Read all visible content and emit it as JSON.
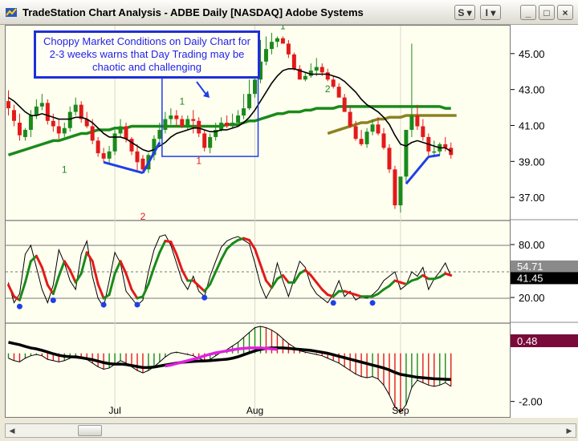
{
  "window": {
    "title": "TradeStation Chart Analysis - ADBE Daily [NASDAQ] Adobe Systems",
    "buttons": {
      "s_label": "S",
      "i_label": "I",
      "min_label": "_",
      "max_label": "□",
      "close_label": "×"
    }
  },
  "annotation": {
    "callout_text": "Choppy Market Conditions on Daily Chart for 2-3 weeks warns that Day Trading may be chaotic and challenging"
  },
  "chart_data": [
    {
      "type": "candlestick",
      "panel": "price",
      "symbol": "ADBE Daily [NASDAQ]",
      "ylim": [
        35.8,
        46.6
      ],
      "y_ticks": [
        "45.00",
        "43.00",
        "41.00",
        "39.00",
        "37.00"
      ],
      "annotations": [
        "1",
        "2",
        "1",
        "1",
        "2",
        "1"
      ],
      "colors": {
        "up": "#1a8a1a",
        "down": "#e21a1a",
        "fast_ma": "#000000",
        "mid_ma": "#1a8a1a",
        "slow_ma": "#8c8220",
        "divergence": "#1f3fe6"
      },
      "x": [
        1,
        2,
        3,
        4,
        5,
        6,
        7,
        8,
        9,
        10,
        11,
        12,
        13,
        14,
        15,
        16,
        17,
        18,
        19,
        20,
        21,
        22,
        23,
        24,
        25,
        26,
        27,
        28,
        29,
        30,
        31,
        32,
        33,
        34,
        35,
        36,
        37,
        38,
        39,
        40,
        41,
        42,
        43,
        44,
        45,
        46,
        47,
        48,
        49,
        50,
        51,
        52,
        53,
        54,
        55,
        56,
        57,
        58,
        59,
        60,
        61,
        62,
        63,
        64,
        65,
        66,
        67,
        68,
        69,
        70,
        71,
        72,
        73,
        74,
        75,
        76,
        77,
        78,
        79,
        80,
        81,
        82,
        83,
        84,
        85,
        86,
        87,
        88,
        89,
        90
      ],
      "open": [
        42.4,
        41.9,
        41.2,
        40.4,
        40.8,
        41.6,
        42.1,
        42.3,
        41.3,
        41.0,
        40.6,
        40.9,
        41.8,
        42.2,
        41.4,
        41.0,
        40.2,
        39.5,
        39.2,
        39.6,
        40.6,
        41.0,
        40.3,
        39.6,
        39.2,
        38.6,
        39.4,
        40.3,
        40.8,
        41.4,
        41.6,
        41.4,
        41.0,
        41.4,
        41.3,
        40.6,
        39.8,
        40.4,
        40.8,
        41.2,
        41.0,
        41.2,
        41.6,
        42.0,
        42.8,
        43.6,
        44.6,
        45.3,
        45.7,
        45.9,
        45.6,
        45.0,
        44.2,
        43.6,
        43.8,
        44.1,
        44.3,
        44.0,
        43.6,
        43.2,
        42.6,
        41.8,
        41.0,
        40.3,
        40.0,
        40.7,
        41.1,
        40.6,
        39.8,
        38.6,
        36.6,
        38.2,
        40.8,
        41.6,
        41.0,
        40.4,
        39.6,
        39.6,
        40.0,
        39.8
      ],
      "high": [
        43.0,
        42.2,
        41.7,
        40.9,
        41.9,
        42.5,
        42.8,
        42.5,
        41.7,
        41.4,
        41.2,
        42.1,
        42.6,
        42.4,
        41.8,
        41.4,
        40.4,
        39.8,
        39.9,
        40.8,
        41.4,
        41.2,
        40.4,
        40.0,
        39.4,
        39.5,
        40.5,
        41.2,
        41.8,
        42.0,
        41.9,
        41.6,
        41.6,
        41.9,
        41.5,
        40.8,
        40.6,
        41.2,
        41.5,
        41.6,
        41.7,
        41.9,
        42.8,
        43.6,
        44.6,
        45.8,
        46.0,
        46.2,
        46.0,
        46.0,
        45.8,
        45.1,
        44.4,
        44.0,
        44.5,
        44.8,
        44.5,
        44.2,
        43.8,
        43.4,
        42.8,
        42.1,
        41.3,
        40.8,
        40.9,
        41.4,
        41.5,
        40.9,
        40.0,
        38.8,
        37.8,
        40.6,
        45.6,
        42.2,
        41.4,
        40.6,
        40.2,
        40.1,
        40.4,
        40.1
      ],
      "low": [
        41.6,
        41.0,
        40.2,
        40.2,
        40.4,
        41.4,
        41.9,
        41.1,
        40.7,
        40.3,
        40.4,
        40.7,
        41.6,
        41.2,
        40.9,
        40.0,
        39.3,
        39.0,
        38.9,
        39.4,
        40.4,
        40.1,
        39.4,
        38.5,
        38.4,
        38.4,
        39.1,
        40.1,
        40.6,
        41.1,
        41.0,
        40.9,
        40.8,
        40.6,
        40.4,
        39.6,
        39.5,
        40.2,
        40.7,
        40.9,
        40.9,
        41.2,
        41.4,
        41.9,
        42.6,
        43.4,
        44.4,
        45.0,
        45.4,
        45.6,
        44.8,
        44.1,
        43.6,
        43.5,
        43.7,
        43.8,
        43.8,
        43.5,
        43.1,
        42.6,
        41.8,
        40.9,
        40.2,
        39.9,
        39.8,
        40.5,
        40.5,
        39.7,
        38.4,
        36.4,
        36.2,
        37.8,
        40.4,
        40.8,
        40.2,
        39.3,
        39.4,
        39.4,
        39.6,
        39.2
      ],
      "close": [
        42.0,
        41.3,
        40.5,
        40.8,
        41.6,
        42.1,
        42.3,
        41.3,
        41.0,
        40.6,
        40.9,
        41.8,
        42.2,
        41.4,
        41.0,
        40.2,
        39.5,
        39.2,
        39.6,
        40.6,
        41.0,
        40.3,
        39.6,
        39.0,
        38.6,
        39.4,
        40.3,
        40.8,
        41.4,
        41.6,
        41.4,
        41.0,
        41.4,
        41.3,
        40.6,
        39.8,
        40.4,
        40.8,
        41.2,
        41.0,
        41.2,
        41.6,
        42.0,
        42.8,
        43.6,
        44.6,
        45.3,
        45.7,
        45.9,
        45.6,
        45.0,
        44.2,
        43.6,
        43.8,
        44.1,
        44.3,
        44.0,
        43.6,
        43.2,
        42.6,
        41.8,
        41.0,
        40.3,
        40.0,
        40.7,
        41.1,
        40.6,
        39.8,
        38.6,
        36.6,
        38.2,
        40.8,
        41.6,
        41.0,
        40.4,
        39.6,
        39.6,
        40.0,
        39.8,
        39.4
      ],
      "ma_fast": [
        42.6,
        42.4,
        42.1,
        41.8,
        41.6,
        41.6,
        41.7,
        41.6,
        41.5,
        41.4,
        41.4,
        41.4,
        41.5,
        41.5,
        41.4,
        41.2,
        40.9,
        40.6,
        40.4,
        40.4,
        40.4,
        40.3,
        40.1,
        39.9,
        39.7,
        39.6,
        39.7,
        39.9,
        40.1,
        40.4,
        40.6,
        40.7,
        40.8,
        40.9,
        40.9,
        40.8,
        40.7,
        40.7,
        40.8,
        40.8,
        40.9,
        41.0,
        41.2,
        41.5,
        41.9,
        42.4,
        42.9,
        43.4,
        43.8,
        44.1,
        44.2,
        44.2,
        44.1,
        44.0,
        43.9,
        43.9,
        43.9,
        43.9,
        43.8,
        43.7,
        43.5,
        43.2,
        42.9,
        42.5,
        42.2,
        42.0,
        41.8,
        41.5,
        41.1,
        40.5,
        40.0,
        39.9,
        40.1,
        40.2,
        40.1,
        40.0,
        39.9,
        39.8,
        39.8,
        39.6
      ],
      "ma_mid": [
        39.4,
        39.5,
        39.6,
        39.7,
        39.8,
        39.9,
        40.0,
        40.1,
        40.2,
        40.2,
        40.3,
        40.4,
        40.5,
        40.6,
        40.6,
        40.7,
        40.8,
        40.8,
        40.8,
        40.9,
        40.9,
        40.9,
        41.0,
        41.0,
        41.0,
        41.0,
        41.0,
        41.0,
        41.0,
        41.0,
        41.0,
        41.0,
        41.0,
        41.0,
        41.0,
        41.0,
        41.0,
        41.0,
        41.0,
        41.1,
        41.1,
        41.1,
        41.2,
        41.3,
        41.3,
        41.4,
        41.5,
        41.6,
        41.7,
        41.7,
        41.8,
        41.8,
        41.8,
        41.9,
        41.9,
        42.0,
        42.0,
        42.0,
        42.0,
        42.1,
        42.1,
        42.1,
        42.1,
        42.1,
        42.1,
        42.1,
        42.1,
        42.1,
        42.1,
        42.1,
        42.1,
        42.1,
        42.1,
        42.1,
        42.1,
        42.1,
        42.1,
        42.1,
        42.0,
        42.0
      ],
      "ma_slow_start_index": 57,
      "ma_slow": [
        40.6,
        40.7,
        40.8,
        40.9,
        41.0,
        41.1,
        41.2,
        41.2,
        41.3,
        41.4,
        41.4,
        41.5,
        41.5,
        41.5,
        41.6,
        41.6,
        41.6,
        41.6,
        41.6,
        41.6,
        41.6,
        41.6,
        41.6,
        41.6
      ]
    },
    {
      "type": "line",
      "panel": "stochastic",
      "ylim": [
        0,
        100
      ],
      "y_ticks": [
        "80.00",
        "20.00"
      ],
      "reference_lines": [
        80,
        50,
        20
      ],
      "current_values": [
        "54.71",
        "41.45"
      ],
      "fast_k": [
        38,
        15,
        25,
        70,
        80,
        55,
        30,
        15,
        35,
        75,
        60,
        40,
        30,
        70,
        85,
        45,
        20,
        10,
        40,
        72,
        60,
        28,
        20,
        12,
        18,
        50,
        75,
        90,
        92,
        80,
        60,
        40,
        30,
        45,
        28,
        22,
        45,
        62,
        78,
        85,
        88,
        90,
        86,
        82,
        60,
        35,
        20,
        32,
        60,
        40,
        22,
        42,
        62,
        55,
        35,
        25,
        20,
        15,
        25,
        40,
        22,
        28,
        18,
        22,
        20,
        24,
        30,
        40,
        45,
        50,
        30,
        35,
        50,
        45,
        55,
        30,
        42,
        50,
        60,
        45
      ],
      "slow_d": [
        35,
        22,
        18,
        38,
        62,
        68,
        55,
        35,
        25,
        45,
        62,
        52,
        38,
        48,
        72,
        62,
        36,
        20,
        24,
        48,
        62,
        48,
        30,
        20,
        22,
        36,
        55,
        72,
        85,
        84,
        70,
        52,
        40,
        40,
        34,
        28,
        36,
        50,
        64,
        76,
        82,
        86,
        88,
        86,
        76,
        58,
        40,
        32,
        42,
        46,
        38,
        38,
        48,
        52,
        46,
        38,
        30,
        24,
        22,
        28,
        28,
        26,
        24,
        22,
        22,
        22,
        25,
        30,
        34,
        40,
        38,
        36,
        40,
        42,
        46,
        42,
        42,
        44,
        48,
        46
      ],
      "signal_dots_count": 8
    },
    {
      "type": "histogram",
      "panel": "macd",
      "ylim": [
        -2.6,
        1.2
      ],
      "y_ticks": [
        "-2.00"
      ],
      "current_value": "0.48",
      "histogram": [
        -0.2,
        -0.3,
        -0.35,
        -0.2,
        -0.1,
        -0.05,
        -0.1,
        -0.25,
        -0.3,
        -0.35,
        -0.3,
        -0.2,
        -0.1,
        -0.15,
        -0.25,
        -0.4,
        -0.55,
        -0.65,
        -0.6,
        -0.45,
        -0.3,
        -0.4,
        -0.55,
        -0.7,
        -0.8,
        -0.7,
        -0.55,
        -0.35,
        -0.15,
        0.0,
        0.05,
        0.0,
        -0.05,
        -0.1,
        -0.2,
        -0.3,
        -0.25,
        -0.1,
        0.05,
        0.15,
        0.3,
        0.45,
        0.65,
        0.85,
        1.05,
        1.1,
        1.05,
        0.95,
        0.8,
        0.6,
        0.4,
        0.25,
        0.1,
        0.05,
        0.0,
        -0.05,
        -0.1,
        -0.2,
        -0.3,
        -0.4,
        -0.55,
        -0.7,
        -0.85,
        -0.95,
        -1.0,
        -0.95,
        -1.05,
        -1.3,
        -1.7,
        -2.2,
        -2.4,
        -2.1,
        -1.4,
        -1.1,
        -1.2,
        -1.3,
        -1.35,
        -1.3,
        -1.2,
        -1.35
      ],
      "macd_line": [
        0.45,
        0.4,
        0.35,
        0.28,
        0.22,
        0.18,
        0.12,
        0.05,
        -0.02,
        -0.08,
        -0.12,
        -0.14,
        -0.15,
        -0.18,
        -0.22,
        -0.26,
        -0.32,
        -0.38,
        -0.42,
        -0.44,
        -0.44,
        -0.46,
        -0.5,
        -0.54,
        -0.58,
        -0.58,
        -0.56,
        -0.52,
        -0.48,
        -0.44,
        -0.4,
        -0.37,
        -0.35,
        -0.33,
        -0.32,
        -0.31,
        -0.3,
        -0.28,
        -0.26,
        -0.24,
        -0.2,
        -0.14,
        -0.06,
        0.02,
        0.1,
        0.16,
        0.2,
        0.22,
        0.22,
        0.22,
        0.2,
        0.18,
        0.16,
        0.14,
        0.12,
        0.08,
        0.04,
        0.0,
        -0.06,
        -0.12,
        -0.18,
        -0.24,
        -0.3,
        -0.36,
        -0.42,
        -0.48,
        -0.54,
        -0.6,
        -0.68,
        -0.78,
        -0.86,
        -0.9,
        -0.94,
        -0.98,
        -1.0,
        -1.02,
        -1.04,
        -1.05,
        -1.06,
        -1.07
      ],
      "signal_line_start_index": 28,
      "signal_line": [
        -0.52,
        -0.48,
        -0.42,
        -0.36,
        -0.3,
        -0.24,
        -0.18,
        -0.1,
        -0.04,
        0.02,
        0.06,
        0.1,
        0.14,
        0.18,
        0.2,
        0.22,
        0.22,
        0.22,
        0.2,
        0.18,
        0.16
      ],
      "colors": {
        "bars_up": "#1a8a1a",
        "bars_down": "#e21a1a",
        "macd": "#000000",
        "signal": "#e020e0"
      }
    }
  ],
  "x_axis": {
    "month_labels": [
      "Jul",
      "Aug",
      "Sep"
    ]
  }
}
